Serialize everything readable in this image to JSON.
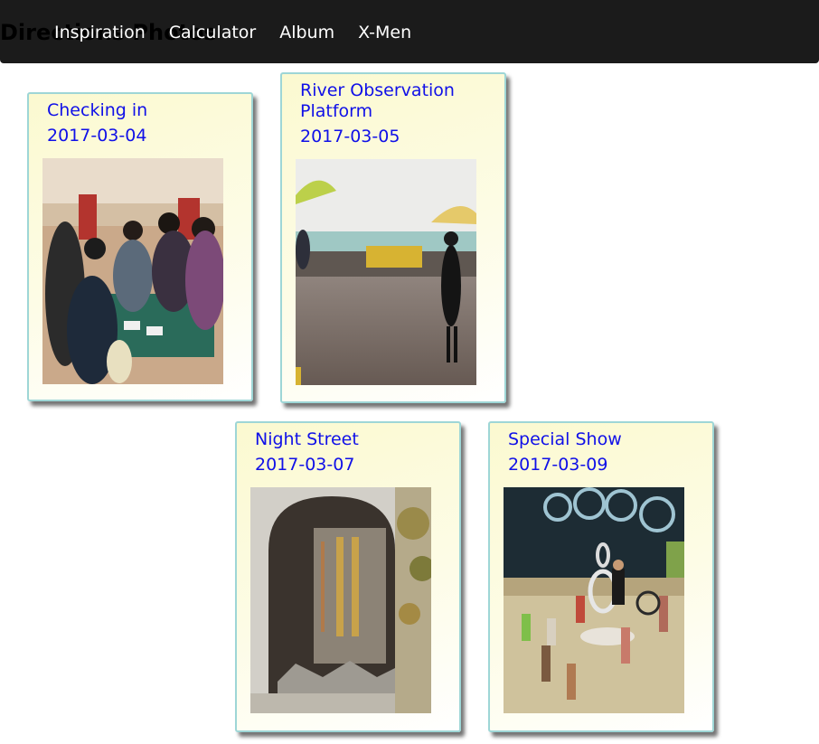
{
  "site": {
    "title": "Directions Photos"
  },
  "nav": {
    "items": [
      "Inspiration",
      "Calculator",
      "Album",
      "X-Men"
    ]
  },
  "album": {
    "cards": [
      {
        "title": "Checking in",
        "date": "2017-03-04",
        "photo_icon": "hotel-lobby-photo"
      },
      {
        "title": "River Observation Platform",
        "date": "2017-03-05",
        "photo_icon": "river-platform-photo"
      },
      {
        "title": "Night Street",
        "date": "2017-03-07",
        "photo_icon": "stone-gate-photo"
      },
      {
        "title": "Special Show",
        "date": "2017-03-09",
        "photo_icon": "acrobat-show-photo"
      }
    ]
  },
  "colors": {
    "navbar": "#1b1b1b",
    "card_border": "#9ed6d6",
    "card_text": "#1010e8"
  }
}
